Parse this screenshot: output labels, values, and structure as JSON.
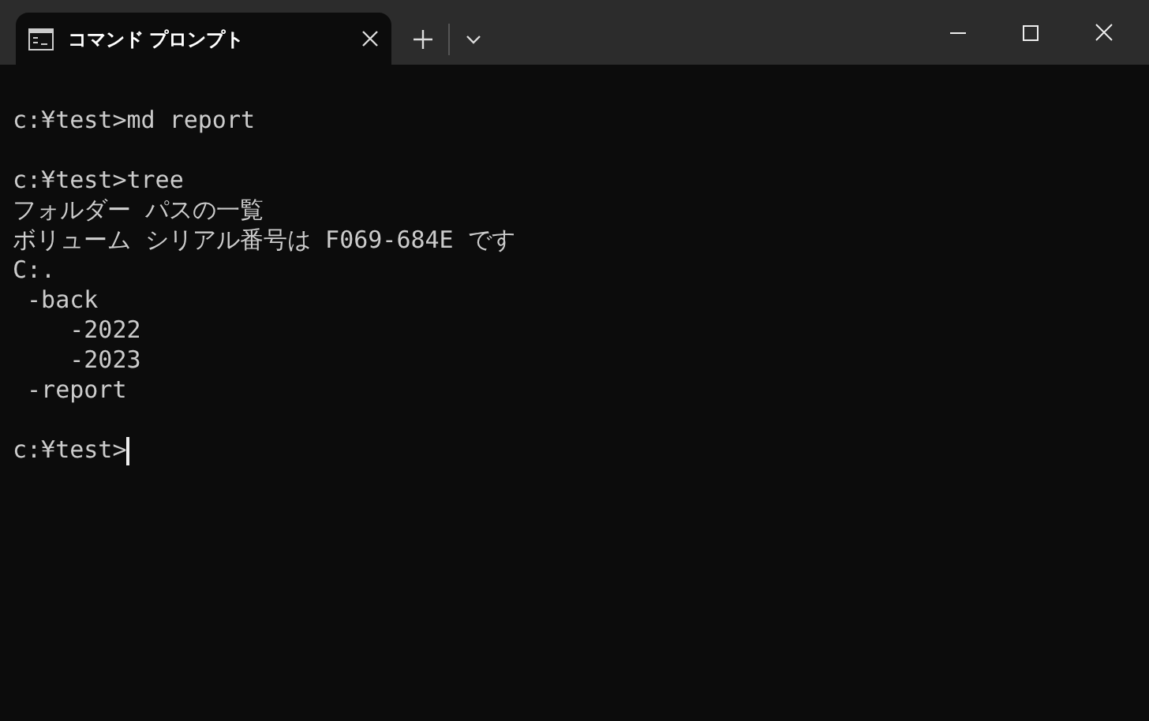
{
  "tabs": [
    {
      "title": "コマンド プロンプト",
      "selected": true
    }
  ],
  "blocks": [
    [
      "c:¥test>md report"
    ],
    [
      "c:¥test>tree",
      "フォルダー パスの一覧",
      "ボリューム シリアル番号は F069-684E です",
      "C:.",
      " -back",
      "    -2022",
      "    -2023",
      " -report"
    ]
  ],
  "prompt": {
    "text": "c:¥test>"
  }
}
